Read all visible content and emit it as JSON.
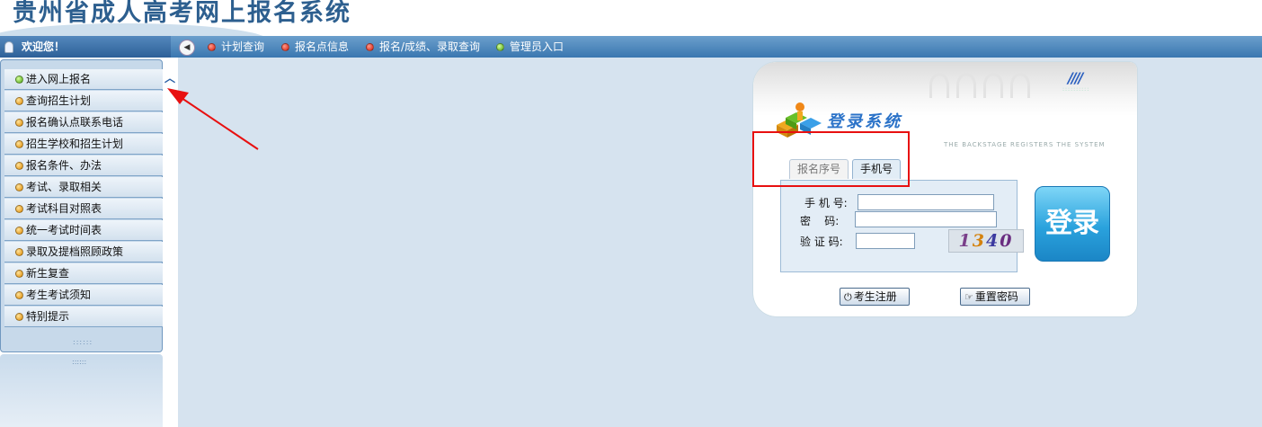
{
  "header": {
    "title": "贵州省成人高考网上报名系统"
  },
  "navbar": {
    "welcome": "欢迎您！",
    "items": [
      {
        "label": "计划查询",
        "dot": "red"
      },
      {
        "label": "报名点信息",
        "dot": "red"
      },
      {
        "label": "报名/成绩、录取查询",
        "dot": "red"
      },
      {
        "label": "管理员入口",
        "dot": "green"
      }
    ]
  },
  "sidebar": {
    "items": [
      {
        "label": "进入网上报名",
        "dot": "green"
      },
      {
        "label": "查询招生计划",
        "dot": "orange"
      },
      {
        "label": "报名确认点联系电话",
        "dot": "orange"
      },
      {
        "label": "招生学校和招生计划",
        "dot": "orange"
      },
      {
        "label": "报名条件、办法",
        "dot": "orange"
      },
      {
        "label": "考试、录取相关",
        "dot": "orange"
      },
      {
        "label": "考试科目对照表",
        "dot": "orange"
      },
      {
        "label": "统一考试时间表",
        "dot": "orange"
      },
      {
        "label": "录取及提档照顾政策",
        "dot": "orange"
      },
      {
        "label": "新生复查",
        "dot": "orange"
      },
      {
        "label": "考生考试须知",
        "dot": "orange"
      },
      {
        "label": "特别提示",
        "dot": "orange"
      }
    ]
  },
  "login": {
    "system_title": "登录系统",
    "subtitle": "THE BACKSTAGE REGISTERS THE SYSTEM",
    "tabs": [
      {
        "label": "报名序号",
        "active": false
      },
      {
        "label": "手机号",
        "active": true
      }
    ],
    "phone_label": "手 机 号:",
    "password_label": "密    码:",
    "captcha_label": "验 证 码:",
    "phone_value": "",
    "password_value": "",
    "captcha_value": "",
    "captcha_digits": [
      "1",
      "3",
      "4",
      "0"
    ],
    "login_button": "登录",
    "register_button": "考生注册",
    "reset_button": "重置密码"
  },
  "colors": {
    "accent": "#3a77b0",
    "highlight": "#e81010",
    "login_button": "#2aa2dd"
  }
}
